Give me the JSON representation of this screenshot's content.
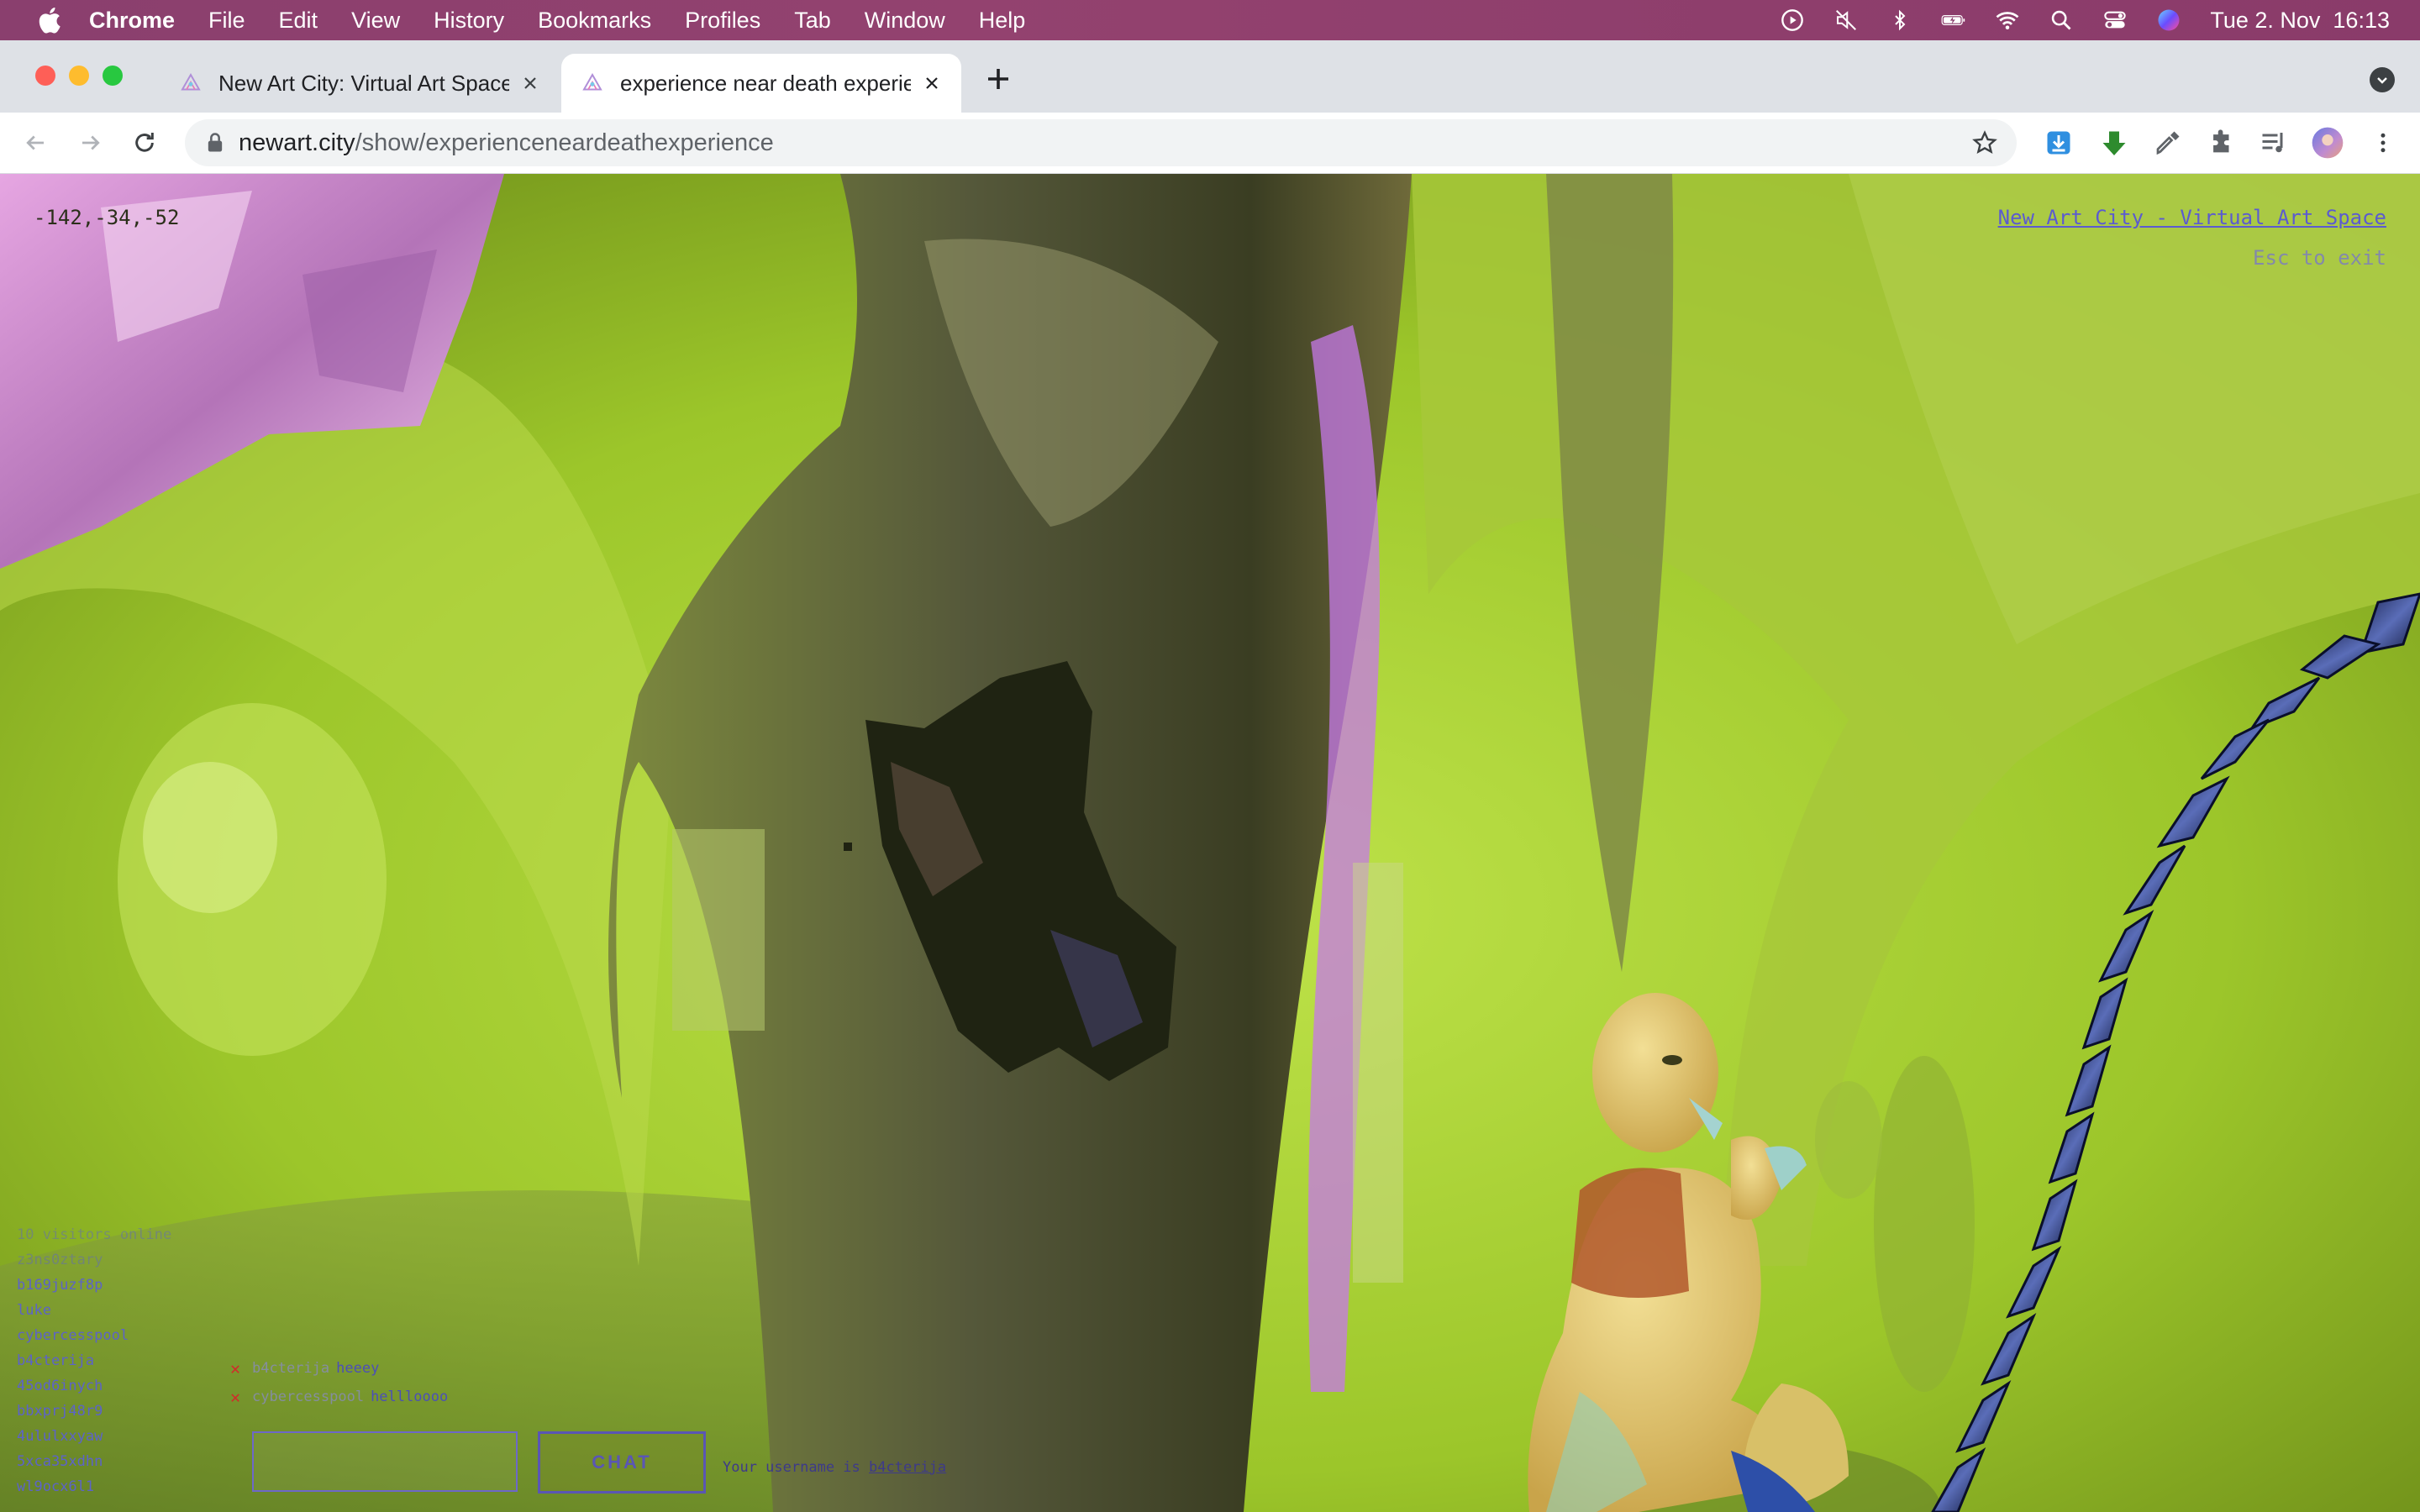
{
  "menubar": {
    "app_name": "Chrome",
    "items": [
      "File",
      "Edit",
      "View",
      "History",
      "Bookmarks",
      "Profiles",
      "Tab",
      "Window",
      "Help"
    ],
    "clock": "Tue 2. Nov  16:13",
    "status_icons": [
      "play-icon",
      "mute-icon",
      "bluetooth-icon",
      "battery-charging-icon",
      "wifi-icon",
      "spotlight-search-icon",
      "control-center-icon",
      "siri-icon"
    ]
  },
  "tabs": [
    {
      "title": "New Art City: Virtual Art Space",
      "active": false
    },
    {
      "title": "experience near death experien",
      "active": true
    }
  ],
  "toolbar": {
    "url_host": "newart.city",
    "url_path": "/show/experienceneardeathexperience",
    "extensions": [
      "download-extension-icon",
      "green-arrow-extension-icon",
      "eyedropper-extension-icon",
      "puzzle-extensions-icon",
      "reading-list-icon",
      "profile-avatar",
      "kebab-menu-icon"
    ]
  },
  "viewport": {
    "coords": "-142,-34,-52",
    "brand_link": "New Art City - Virtual Art Space",
    "esc_hint": "Esc to exit",
    "users_header": "10 visitors online",
    "users": [
      "z3ns0ztary",
      "b169juzf8p",
      "luke",
      "cybercesspool",
      "b4cterija",
      "45od6inych",
      "bbxprj48r9",
      "4ululxxyaw",
      "5xca35xdhn",
      "wl9ocx6l1"
    ],
    "chat": [
      {
        "user": "b4cterija",
        "message": "heeey"
      },
      {
        "user": "cybercesspool",
        "message": "hellloooo"
      }
    ],
    "chat_input_value": "",
    "chat_button": "CHAT",
    "username_prefix": "Your username is",
    "username": "b4cterija"
  },
  "colors": {
    "menubar": "#8a3f6e",
    "scene_green": "#9fc62c",
    "ui_purple": "#5c63c8"
  }
}
